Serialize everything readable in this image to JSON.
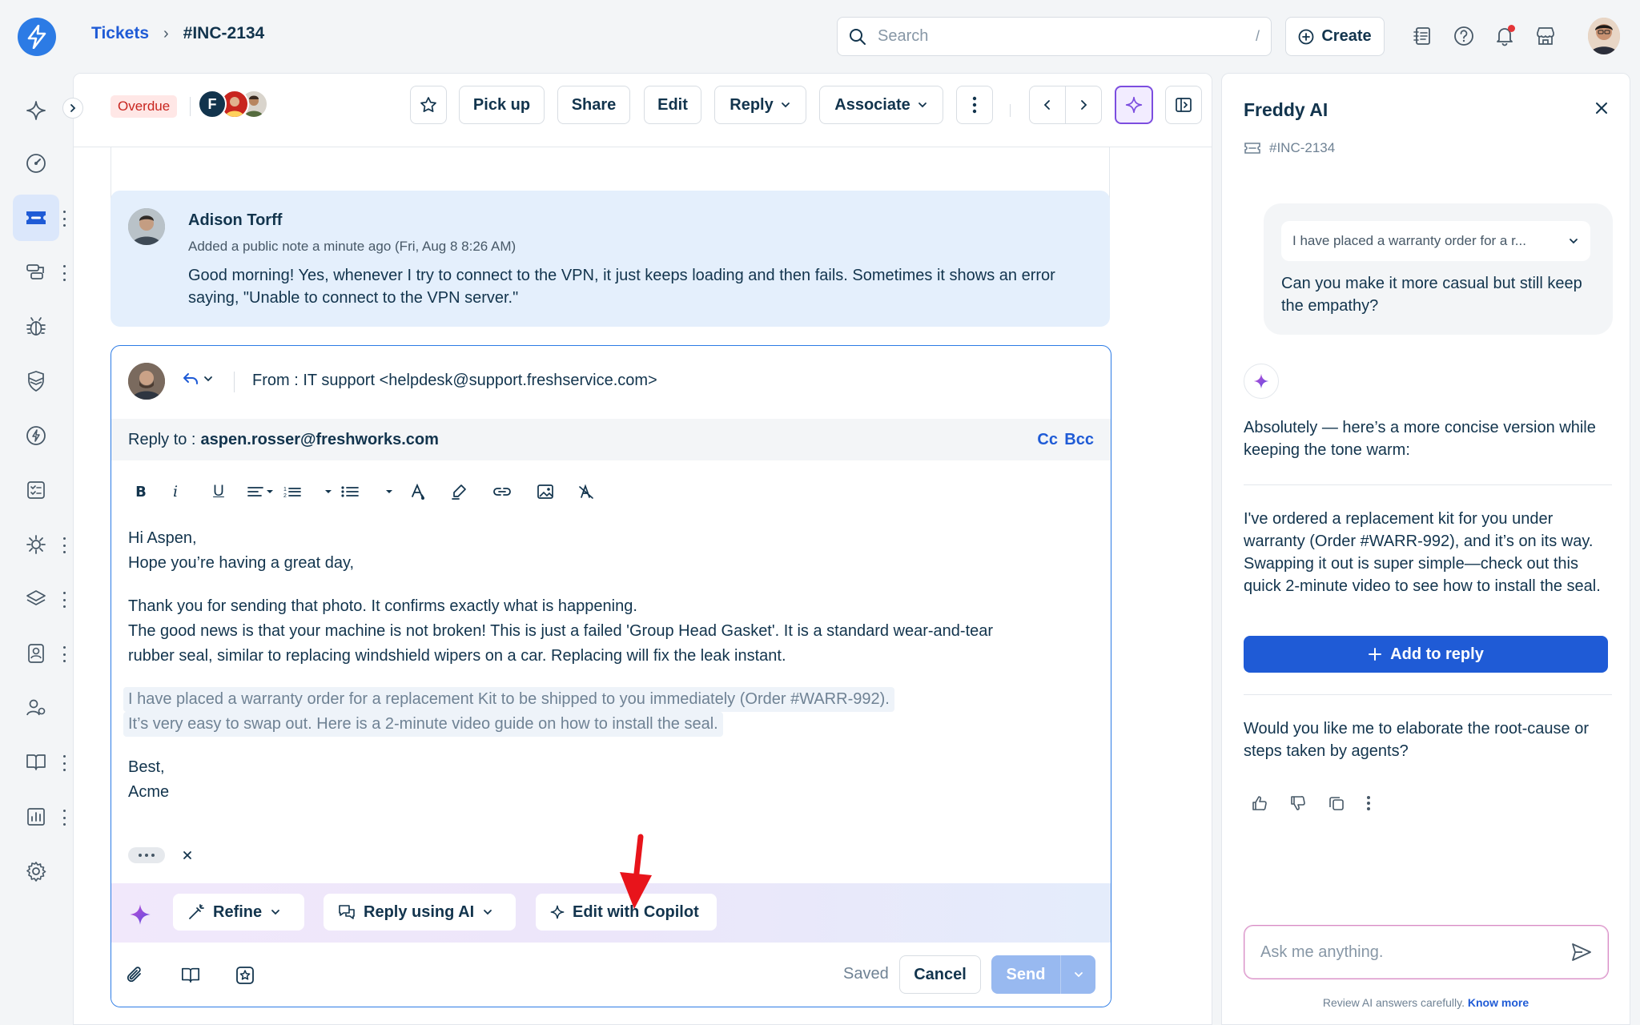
{
  "breadcrumb": {
    "root": "Tickets",
    "separator": "›",
    "current": "#INC-2134"
  },
  "search": {
    "placeholder": "Search",
    "shortcut": "/"
  },
  "create_label": "Create",
  "ticket_header": {
    "status_badge": "Overdue",
    "agent_initial": "F",
    "buttons": {
      "pick_up": "Pick up",
      "share": "Share",
      "edit": "Edit",
      "reply": "Reply",
      "associate": "Associate"
    }
  },
  "note": {
    "author": "Adison Torff",
    "meta": "Added a public note a minute ago (Fri, Aug 8 8:26 AM)",
    "body": "Good morning! Yes, whenever I try to connect to the VPN, it just keeps loading and then fails. Sometimes it shows an error saying, \"Unable to connect to the VPN server.\""
  },
  "reply_editor": {
    "from_label": "From :",
    "from_value": "IT support <helpdesk@support.freshservice.com>",
    "reply_to_label": "Reply to :",
    "reply_to_value": "aspen.rosser@freshworks.com",
    "cc": "Cc",
    "bcc": "Bcc",
    "body": {
      "greeting": "Hi Aspen,",
      "line2": "Hope you’re having a great day,",
      "p1_l1": "Thank you for sending that photo. It confirms exactly what is happening.",
      "p1_l2": "The good news is that your machine is not broken! This is just a failed 'Group Head Gasket'. It is a standard wear-and-tear",
      "p1_l3": "rubber seal, similar to replacing windshield wipers on a car. Replacing will fix the leak instant.",
      "hl_l1": "I have placed a warranty order for a replacement Kit to be shipped to you immediately (Order #WARR-992).",
      "hl_l2": "It’s very easy to swap out. Here is a 2-minute video guide on how to install the seal.",
      "signoff": "Best,",
      "signature": "Acme"
    },
    "ai_bar": {
      "refine": "Refine",
      "reply_ai": "Reply using AI",
      "copilot": "Edit with Copilot"
    },
    "footer": {
      "saved": "Saved",
      "cancel": "Cancel",
      "send": "Send"
    }
  },
  "freddy": {
    "title": "Freddy AI",
    "ticket_ref": "#INC-2134",
    "context_snippet": "I have placed a warranty order for a r...",
    "user_message": "Can you make it more casual but still keep the empathy?",
    "ai_intro": "Absolutely — here’s a more concise version while keeping the tone warm:",
    "ai_draft": "I've ordered a replacement kit for you under warranty (Order #WARR-992), and it’s on its way. Swapping it out is super simple—check out this quick 2-minute video to see how to install the seal.",
    "add_to_reply": "Add to reply",
    "followup": "Would you like me to elaborate the root-cause or steps taken by agents?",
    "ask_placeholder": "Ask me anything.",
    "disclaimer": "Review AI answers carefully.",
    "know_more": "Know more"
  },
  "colors": {
    "primary": "#1f5bd6",
    "ai_accent": "#7c4ddf",
    "overdue": "#c8251f",
    "annotation_arrow": "#e8141b"
  }
}
